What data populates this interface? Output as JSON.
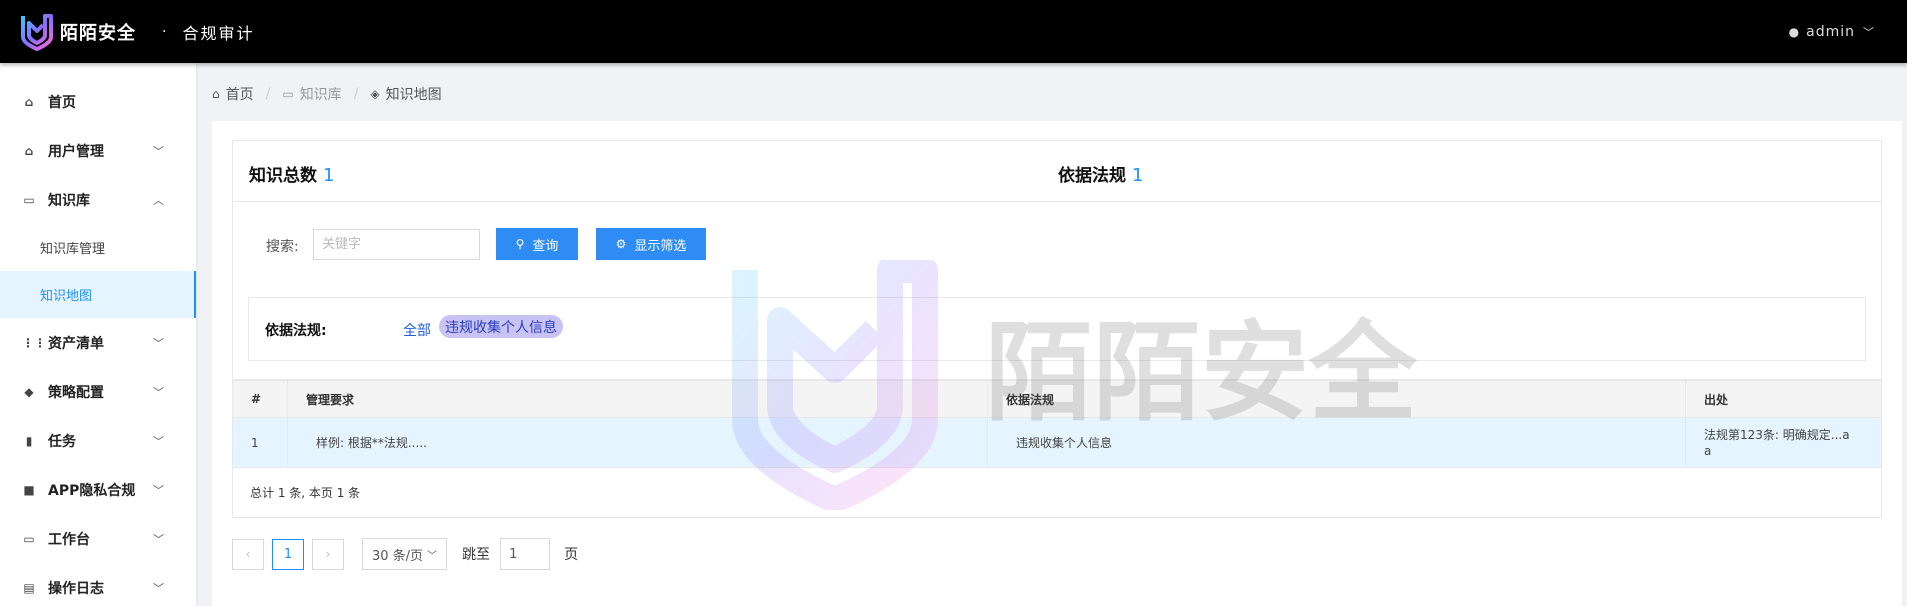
{
  "header": {
    "brand": "陌陌安全",
    "separator": "·",
    "title": "合规审计",
    "user": "admin"
  },
  "sidebar": {
    "items": [
      {
        "label": "首页",
        "icon": "home-icon"
      },
      {
        "label": "用户管理",
        "icon": "home-icon"
      },
      {
        "label": "知识库",
        "icon": "book-icon"
      },
      {
        "label": "知识库管理"
      },
      {
        "label": "知识地图"
      },
      {
        "label": "资产清单",
        "icon": "grid-icon"
      },
      {
        "label": "策略配置",
        "icon": "cube-icon"
      },
      {
        "label": "任务",
        "icon": "bar-chart-icon"
      },
      {
        "label": "APP隐私合规",
        "icon": "briefcase-icon"
      },
      {
        "label": "工作台",
        "icon": "desktop-icon"
      },
      {
        "label": "操作日志",
        "icon": "log-icon"
      }
    ]
  },
  "breadcrumb": {
    "items": [
      "首页",
      "知识库",
      "知识地图"
    ]
  },
  "stats": {
    "total_label": "知识总数",
    "total_value": "1",
    "law_label": "依据法规",
    "law_value": "1"
  },
  "search": {
    "label": "搜索:",
    "placeholder": "关键字",
    "query_button": "查询",
    "filter_button": "显示筛选"
  },
  "law_filter": {
    "label": "依据法规:",
    "all": "全部",
    "tags": [
      "违规收集个人信息"
    ]
  },
  "table": {
    "headers": [
      "#",
      "管理要求",
      "依据法规",
      "出处"
    ],
    "rows": [
      [
        "1",
        "样例: 根据**法规.....",
        "违规收集个人信息",
        "法规第123条: 明确规定...a",
        "a"
      ]
    ],
    "footer": "总计 1 条, 本页 1 条"
  },
  "pagination": {
    "prev": "‹",
    "current": "1",
    "next": "›",
    "page_size": "30 条/页",
    "jump_label": "跳至",
    "jump_value": "1",
    "page_unit": "页"
  },
  "watermark": {
    "text": "陌陌安全"
  },
  "colors": {
    "accent": "#1e90ff",
    "button": "#2f8cf5",
    "topbar": "#000000",
    "selected_row": "#e6f4ff",
    "tag_bg": "#c9c2f5"
  }
}
